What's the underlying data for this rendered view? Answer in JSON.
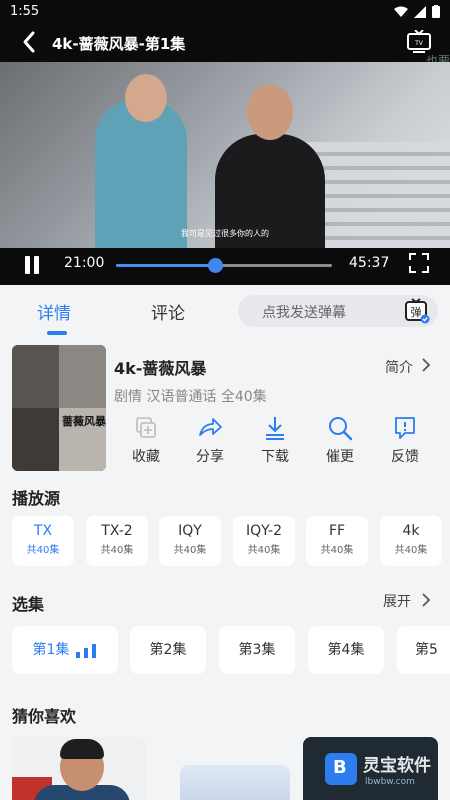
{
  "status_bar": {
    "time": "1:55"
  },
  "player": {
    "title": "4k-蔷薇风暴-第1集",
    "side_text": "也要 着",
    "subtitle": "我可是见过很多你的人的",
    "current_time": "21:00",
    "total_time": "45:37",
    "progress": 0.46
  },
  "tabs": [
    {
      "label": "详情",
      "active": true
    },
    {
      "label": "评论",
      "active": false
    }
  ],
  "danmu": {
    "placeholder": "点我发送弹幕"
  },
  "show": {
    "title": "4k-蔷薇风暴",
    "meta": "剧情 汉语普通话 全40集",
    "intro_label": "简介",
    "poster_logo": "蔷薇风暴"
  },
  "actions": [
    {
      "label": "收藏",
      "icon": "favorite-icon"
    },
    {
      "label": "分享",
      "icon": "share-icon"
    },
    {
      "label": "下载",
      "icon": "download-icon"
    },
    {
      "label": "催更",
      "icon": "search-icon"
    },
    {
      "label": "反馈",
      "icon": "feedback-icon"
    }
  ],
  "sources": {
    "title": "播放源",
    "items": [
      {
        "name": "TX",
        "count": "共40集",
        "active": true
      },
      {
        "name": "TX-2",
        "count": "共40集",
        "active": false
      },
      {
        "name": "IQY",
        "count": "共40集",
        "active": false
      },
      {
        "name": "IQY-2",
        "count": "共40集",
        "active": false
      },
      {
        "name": "FF",
        "count": "共40集",
        "active": false
      },
      {
        "name": "4k",
        "count": "共40集",
        "active": false
      }
    ]
  },
  "episodes": {
    "title": "选集",
    "expand_label": "展开",
    "items": [
      {
        "label": "第1集",
        "active": true
      },
      {
        "label": "第2集",
        "active": false
      },
      {
        "label": "第3集",
        "active": false
      },
      {
        "label": "第4集",
        "active": false
      },
      {
        "label": "第5",
        "active": false
      }
    ]
  },
  "recommend": {
    "title": "猜你喜欢",
    "watermark_text": "灵宝软件",
    "watermark_url": "lbwbw.com"
  },
  "colors": {
    "accent": "#2d7df0",
    "background": "#f3f4f6",
    "player_bg": "#0b0b0c"
  }
}
